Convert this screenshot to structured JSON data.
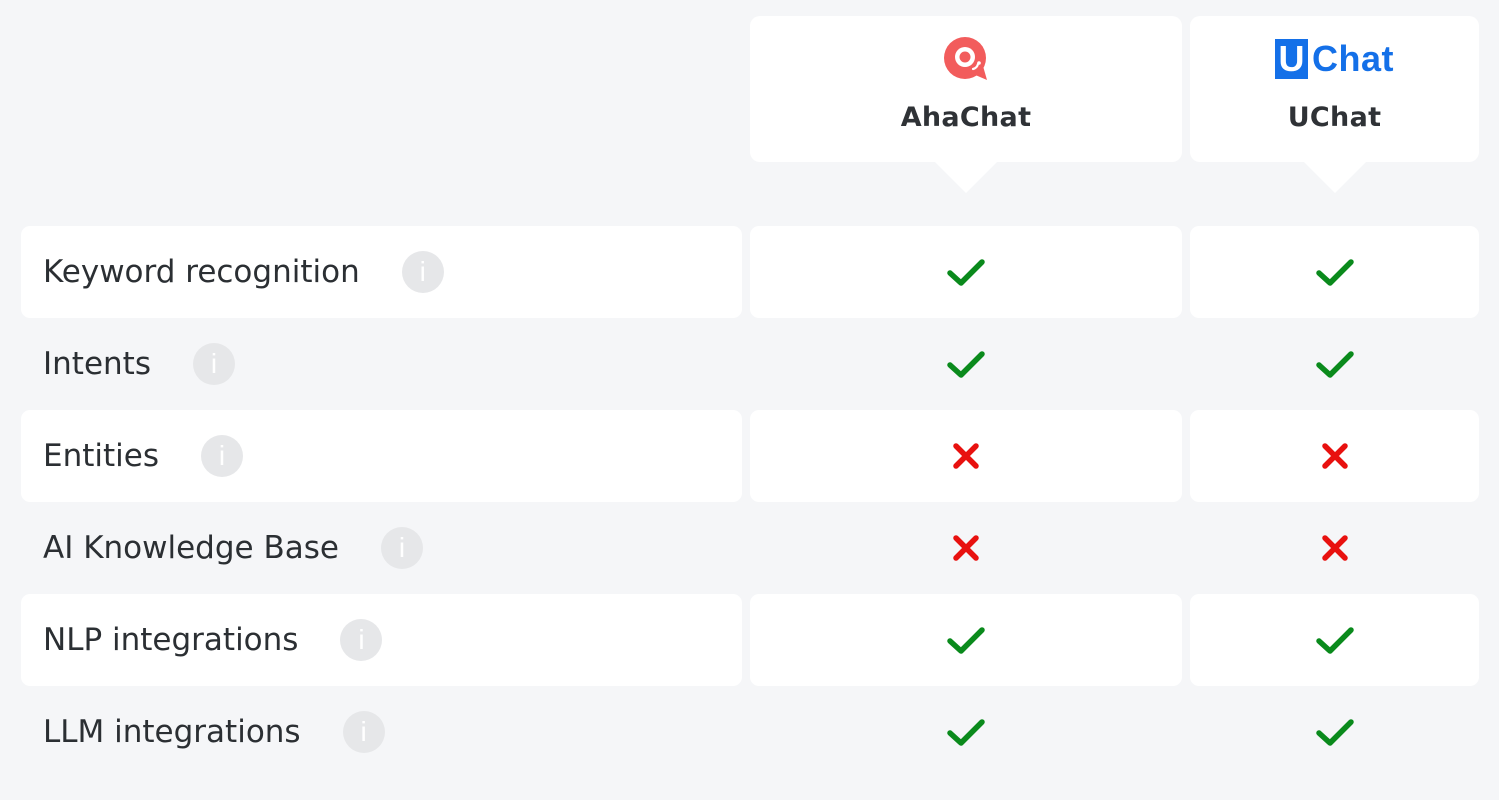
{
  "vendors": [
    {
      "name": "AhaChat",
      "logo_icon": "ahachat-logo-icon",
      "brand_color": "#f25c5c"
    },
    {
      "name": "UChat",
      "logo_icon": "uchat-logo-icon",
      "logo_letter": "U",
      "logo_text": "Chat",
      "brand_color": "#1470e8"
    }
  ],
  "info_glyph": "i",
  "status_colors": {
    "yes": "#0a8a1c",
    "no": "#e8110f"
  },
  "features": [
    {
      "label": "Keyword recognition",
      "ahachat": "yes",
      "uchat": "yes"
    },
    {
      "label": "Intents",
      "ahachat": "yes",
      "uchat": "yes"
    },
    {
      "label": "Entities",
      "ahachat": "no",
      "uchat": "no"
    },
    {
      "label": "AI Knowledge Base",
      "ahachat": "no",
      "uchat": "no"
    },
    {
      "label": "NLP integrations",
      "ahachat": "yes",
      "uchat": "yes"
    },
    {
      "label": "LLM integrations",
      "ahachat": "yes",
      "uchat": "yes"
    }
  ]
}
